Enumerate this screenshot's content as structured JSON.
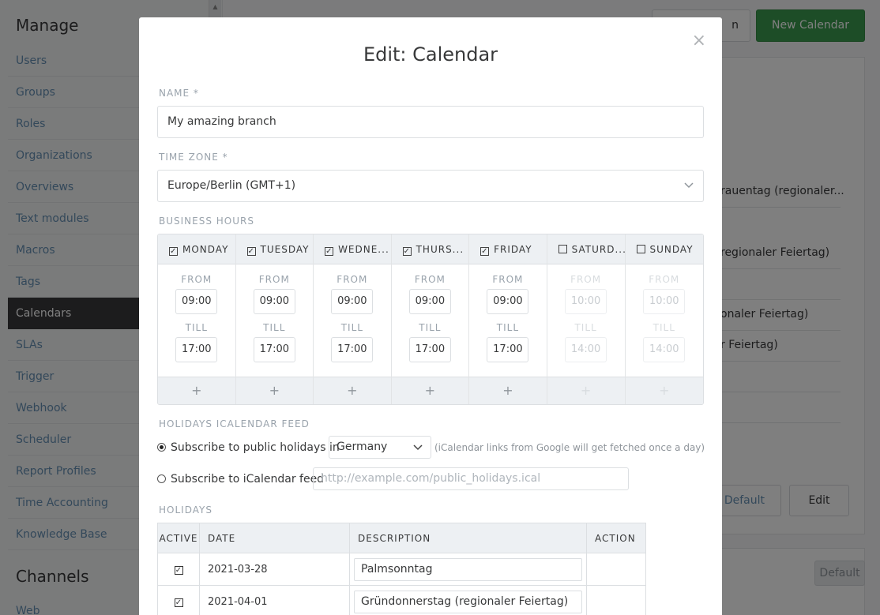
{
  "sidebar": {
    "manage_heading": "Manage",
    "channels_heading": "Channels",
    "items": [
      {
        "label": "Users"
      },
      {
        "label": "Groups"
      },
      {
        "label": "Roles"
      },
      {
        "label": "Organizations"
      },
      {
        "label": "Overviews"
      },
      {
        "label": "Text modules"
      },
      {
        "label": "Macros"
      },
      {
        "label": "Tags"
      },
      {
        "label": "Calendars",
        "active": true
      },
      {
        "label": "SLAs"
      },
      {
        "label": "Trigger"
      },
      {
        "label": "Webhook"
      },
      {
        "label": "Scheduler"
      },
      {
        "label": "Report Profiles"
      },
      {
        "label": "Time Accounting"
      },
      {
        "label": "Knowledge Base"
      }
    ],
    "channel_items": [
      {
        "label": "Web"
      }
    ]
  },
  "background": {
    "header_button_partial": "n",
    "new_calendar_label": "New Calendar",
    "list_texts": [
      "rauentag (regionaler...",
      "regionaler Feiertag)",
      "onaler Feiertag)",
      "r Feiertag)"
    ],
    "default_partial_label": "Default",
    "edit_label": "Edit",
    "default_label": "Default"
  },
  "modal": {
    "title": "Edit: Calendar",
    "close_glyph": "×",
    "name_label": "NAME *",
    "name_value": "My amazing branch",
    "timezone_label": "TIME ZONE *",
    "timezone_value": "Europe/Berlin (GMT+1)",
    "business_hours_label": "BUSINESS HOURS",
    "from_label": "FROM",
    "till_label": "TILL",
    "add_glyph": "+",
    "days": [
      {
        "name": "MONDAY",
        "checked": true,
        "from": "09:00",
        "till": "17:00"
      },
      {
        "name": "TUESDAY",
        "checked": true,
        "from": "09:00",
        "till": "17:00"
      },
      {
        "name": "WEDNE...",
        "checked": true,
        "from": "09:00",
        "till": "17:00"
      },
      {
        "name": "THURS...",
        "checked": true,
        "from": "09:00",
        "till": "17:00"
      },
      {
        "name": "FRIDAY",
        "checked": true,
        "from": "09:00",
        "till": "17:00"
      },
      {
        "name": "SATURD...",
        "checked": false,
        "from": "10:00",
        "till": "14:00"
      },
      {
        "name": "SUNDAY",
        "checked": false,
        "from": "10:00",
        "till": "14:00"
      }
    ],
    "ical_label": "HOLIDAYS ICALENDAR FEED",
    "public_holidays_label": "Subscribe to public holidays in",
    "country_value": "Germany",
    "ical_hint": "(iCalendar links from Google will get fetched once a day)",
    "ical_feed_label": "Subscribe to iCalendar feed",
    "ical_feed_placeholder": "http://example.com/public_holidays.ical",
    "holidays_label": "HOLIDAYS",
    "holidays_columns": [
      "ACTIVE",
      "DATE",
      "DESCRIPTION",
      "ACTION"
    ],
    "holidays": [
      {
        "active": true,
        "date": "2021-03-28",
        "description": "Palmsonntag"
      },
      {
        "active": true,
        "date": "2021-04-01",
        "description": "Gründonnerstag (regionaler Feiertag)"
      }
    ]
  }
}
